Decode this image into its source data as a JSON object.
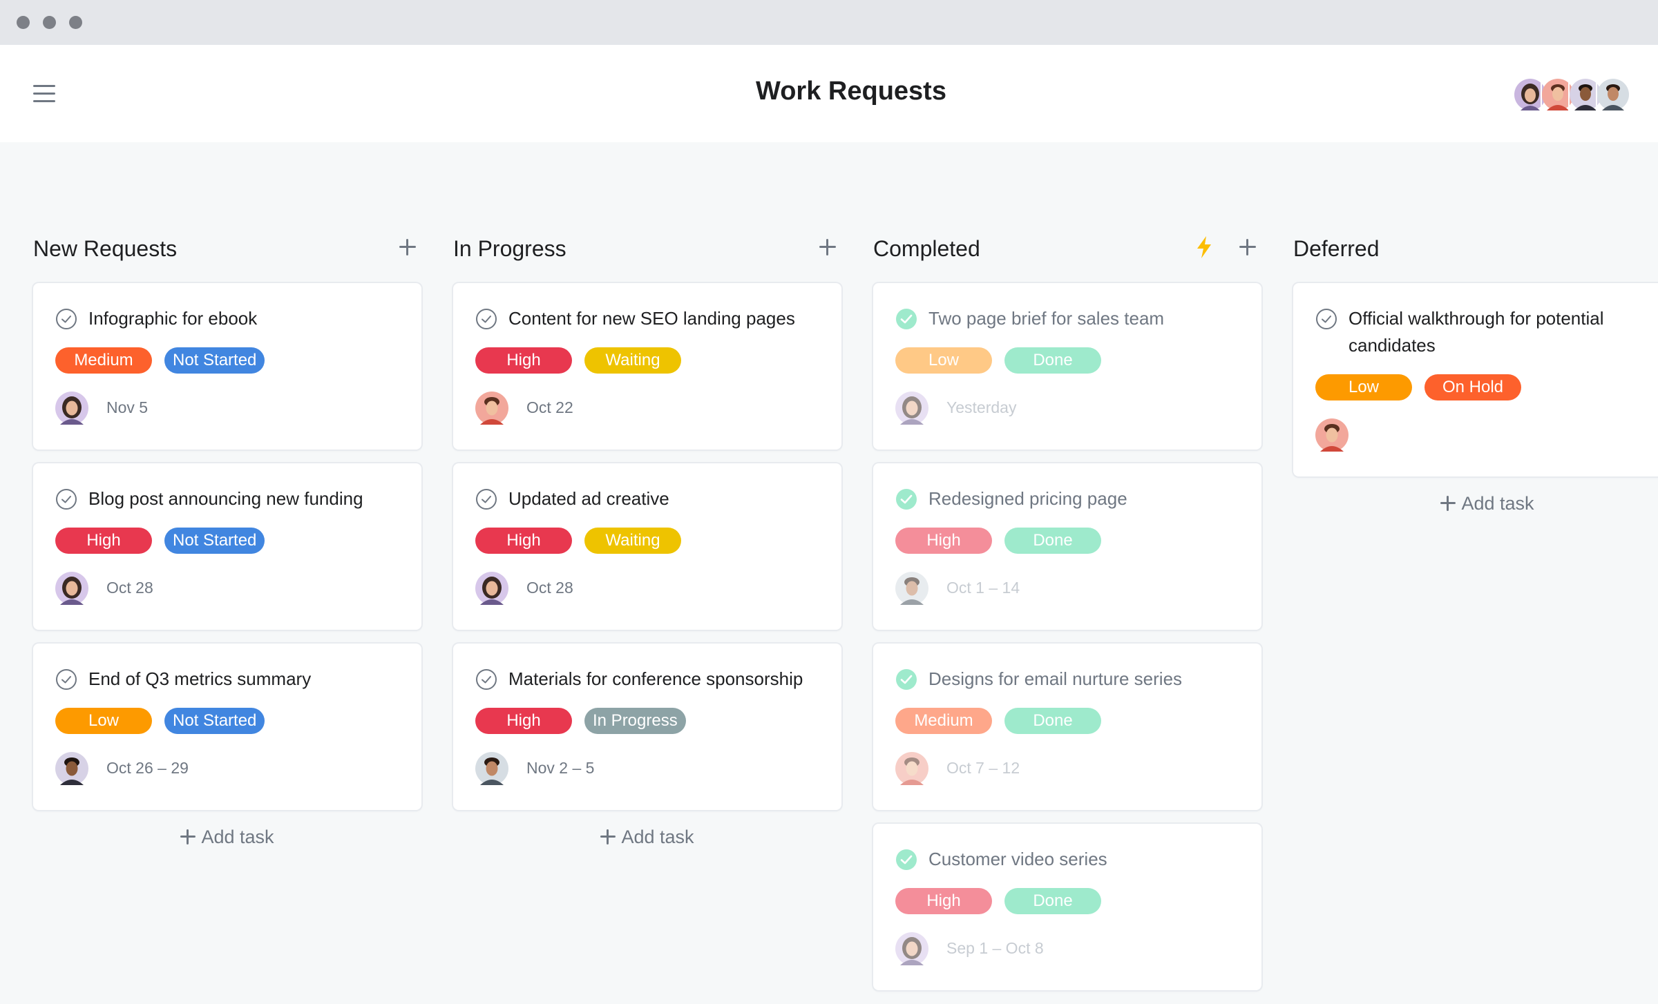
{
  "app": {
    "title": "Work Requests"
  },
  "colors": {
    "medium": "#fd612c",
    "high": "#e8384f",
    "low": "#fd9a00",
    "not_started": "#4186e0",
    "waiting": "#eec300",
    "in_progress": "#8da3a6",
    "on_hold": "#fd612c",
    "done": "#62d26f",
    "low_faded": "#ffc986",
    "high_faded": "#f48e9a",
    "medium_faded": "#fea78a",
    "done_faded": "#9eeacc"
  },
  "header": {
    "menu_icon": "hamburger-menu-icon",
    "avatars": [
      "avatar-woman-1",
      "avatar-man-red-shirt",
      "avatar-man-dark",
      "avatar-man-beard"
    ]
  },
  "columns": [
    {
      "title": "New Requests",
      "add_task": "Add task",
      "cards": [
        {
          "title": "Infographic for ebook",
          "priority": "Medium",
          "status": "Not Started",
          "date": "Nov 5"
        },
        {
          "title": "Blog post announcing new funding",
          "priority": "High",
          "status": "Not Started",
          "date": "Oct 28"
        },
        {
          "title": "End of Q3 metrics summary",
          "priority": "Low",
          "status": "Not Started",
          "date": "Oct 26 – 29"
        }
      ]
    },
    {
      "title": "In Progress",
      "add_task": "Add task",
      "cards": [
        {
          "title": "Content for new SEO landing pages",
          "priority": "High",
          "status": "Waiting",
          "date": "Oct 22"
        },
        {
          "title": "Updated ad creative",
          "priority": "High",
          "status": "Waiting",
          "date": "Oct 28"
        },
        {
          "title": "Materials for conference sponsorship",
          "priority": "High",
          "status": "In Progress",
          "date": "Nov 2 – 5"
        }
      ]
    },
    {
      "title": "Completed",
      "add_task": "",
      "cards": [
        {
          "title": "Two page brief for sales team",
          "priority": "Low",
          "status": "Done",
          "date": "Yesterday"
        },
        {
          "title": "Redesigned pricing page",
          "priority": "High",
          "status": "Done",
          "date": "Oct 1 – 14"
        },
        {
          "title": "Designs for email nurture series",
          "priority": "Medium",
          "status": "Done",
          "date": "Oct 7 – 12"
        },
        {
          "title": "Customer video series",
          "priority": "High",
          "status": "Done",
          "date": "Sep 1 – Oct 8"
        }
      ]
    },
    {
      "title": "Deferred",
      "add_task": "Add task",
      "cards": [
        {
          "title": "Official walkthrough for potential candidates",
          "priority": "Low",
          "status": "On Hold",
          "date": ""
        }
      ]
    }
  ]
}
